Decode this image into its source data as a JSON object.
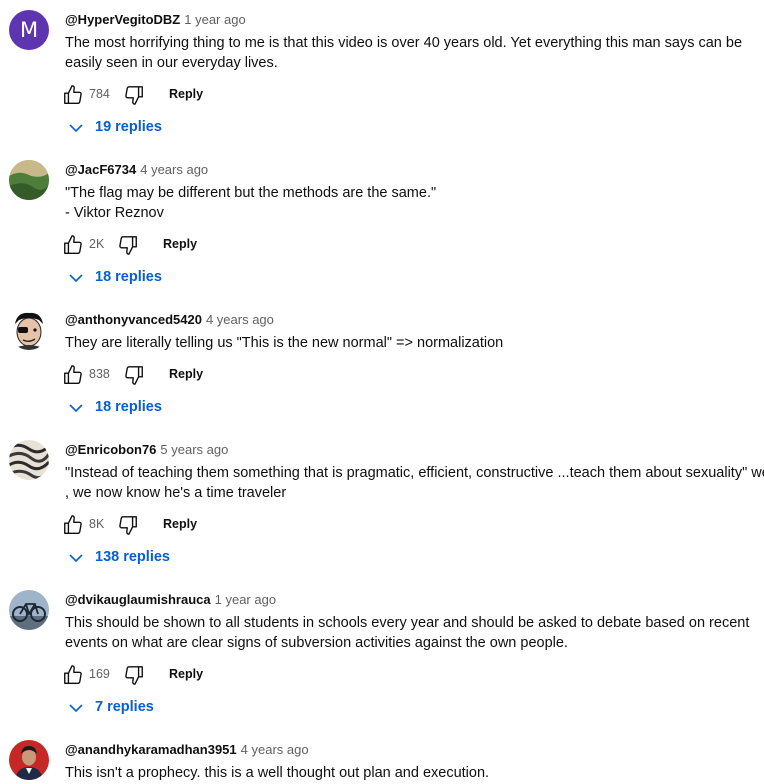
{
  "comments": [
    {
      "author": "@HyperVegitoDBZ",
      "time": "1 year ago",
      "avatar_letter": "M",
      "text": "The most horrifying thing to me is that this video is over 40 years old. Yet everything this man says can be easily seen in our everyday lives.",
      "likes": "784",
      "reply_label": "Reply",
      "replies": "19 replies"
    },
    {
      "author": "@JacF6734",
      "time": "4 years ago",
      "text_lines": [
        "\"The flag may be different but the methods are the same.\"",
        "- Viktor Reznov"
      ],
      "likes": "2K",
      "reply_label": "Reply",
      "replies": "18 replies"
    },
    {
      "author": "@anthonyvanced5420",
      "time": "4 years ago",
      "text": "They are literally telling us \"This is the new normal\" => normalization",
      "likes": "838",
      "reply_label": "Reply",
      "replies": "18 replies"
    },
    {
      "author": "@Enricobon76",
      "time": "5 years ago",
      "text_lines": [
        "\"Instead of teaching them something that is pragmatic, efficient, constructive ...teach them about sexuality\" well",
        ", we now know he's a time traveler"
      ],
      "likes": "8K",
      "reply_label": "Reply",
      "replies": "138 replies"
    },
    {
      "author": "@dvikauglaumishrauca",
      "time": "1 year ago",
      "text_lines": [
        "This should be shown to all students in schools every year and should be asked to debate based on recent",
        "events on what are clear signs of subversion activities against the own people."
      ],
      "likes": "169",
      "reply_label": "Reply",
      "replies": "7 replies"
    },
    {
      "author": "@anandhykaramadhan3951",
      "time": "4 years ago",
      "text": "This isn't a prophecy. this is a well thought out plan and execution."
    }
  ],
  "colors": {
    "link_blue": "#065fd4",
    "meta_gray": "#606060",
    "avatar_purple": "#5e35b1"
  },
  "icons": [
    "thumb-up-icon",
    "thumb-down-icon",
    "chevron-down-icon"
  ]
}
